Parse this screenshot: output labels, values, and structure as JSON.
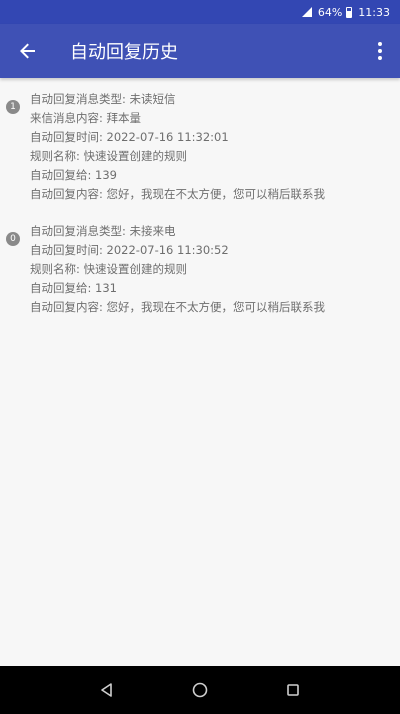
{
  "status_bar": {
    "battery": "64%",
    "time": "11:33"
  },
  "app_bar": {
    "title": "自动回复历史"
  },
  "records": [
    {
      "index": "1",
      "lines": [
        "自动回复消息类型: 未读短信",
        "来信消息内容: 拜本量",
        "自动回复时间: 2022-07-16 11:32:01",
        "规则名称: 快速设置创建的规则",
        "自动回复给: 139",
        "自动回复内容: 您好，我现在不太方便，您可以稍后联系我"
      ]
    },
    {
      "index": "0",
      "lines": [
        "自动回复消息类型: 未接来电",
        "自动回复时间: 2022-07-16 11:30:52",
        "规则名称: 快速设置创建的规则",
        "自动回复给: 131",
        "自动回复内容: 您好，我现在不太方便，您可以稍后联系我"
      ]
    }
  ],
  "icons": {
    "back": "arrow-back-icon",
    "menu": "more-vert-icon",
    "nav_back": "triangle-back-icon",
    "nav_home": "circle-home-icon",
    "nav_recents": "square-recents-icon"
  },
  "colors": {
    "status_bar": "#3347b3",
    "app_bar": "#3f51b5",
    "background": "#f7f7f7",
    "text": "#6e6e6e",
    "nav_bar": "#000000"
  }
}
